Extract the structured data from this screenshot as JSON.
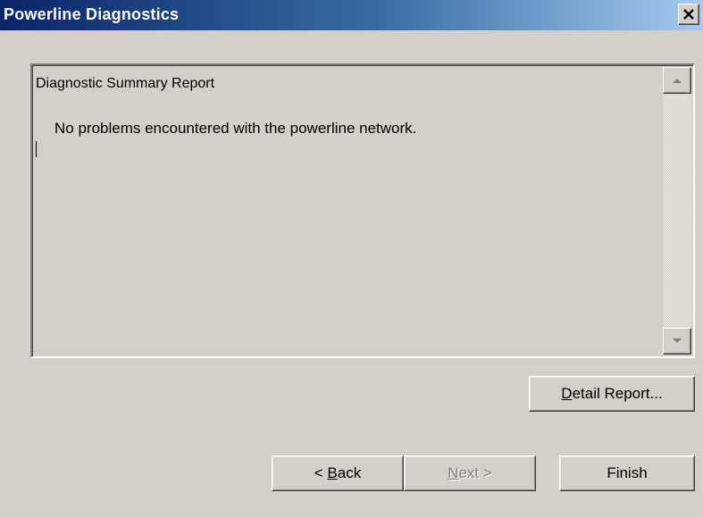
{
  "window": {
    "title": "Powerline Diagnostics",
    "close_icon": "close-icon"
  },
  "report": {
    "heading": "Diagnostic Summary Report",
    "message": "No problems encountered with the powerline network.",
    "scroll_up_icon": "scroll-up-arrow-icon",
    "scroll_down_icon": "scroll-down-arrow-icon"
  },
  "buttons": {
    "detail": {
      "mnemonic": "D",
      "rest": "etail Report...",
      "enabled": true
    },
    "back": {
      "prefix": "< ",
      "mnemonic": "B",
      "rest": "ack",
      "enabled": true
    },
    "next": {
      "mnemonic": "N",
      "rest": "ext >",
      "enabled": false
    },
    "finish": {
      "label": "Finish",
      "enabled": true
    }
  },
  "colors": {
    "titlebar_start": "#0a246a",
    "titlebar_end": "#a6caf0",
    "face": "#d4d0c8",
    "disabled_text": "#808080"
  }
}
